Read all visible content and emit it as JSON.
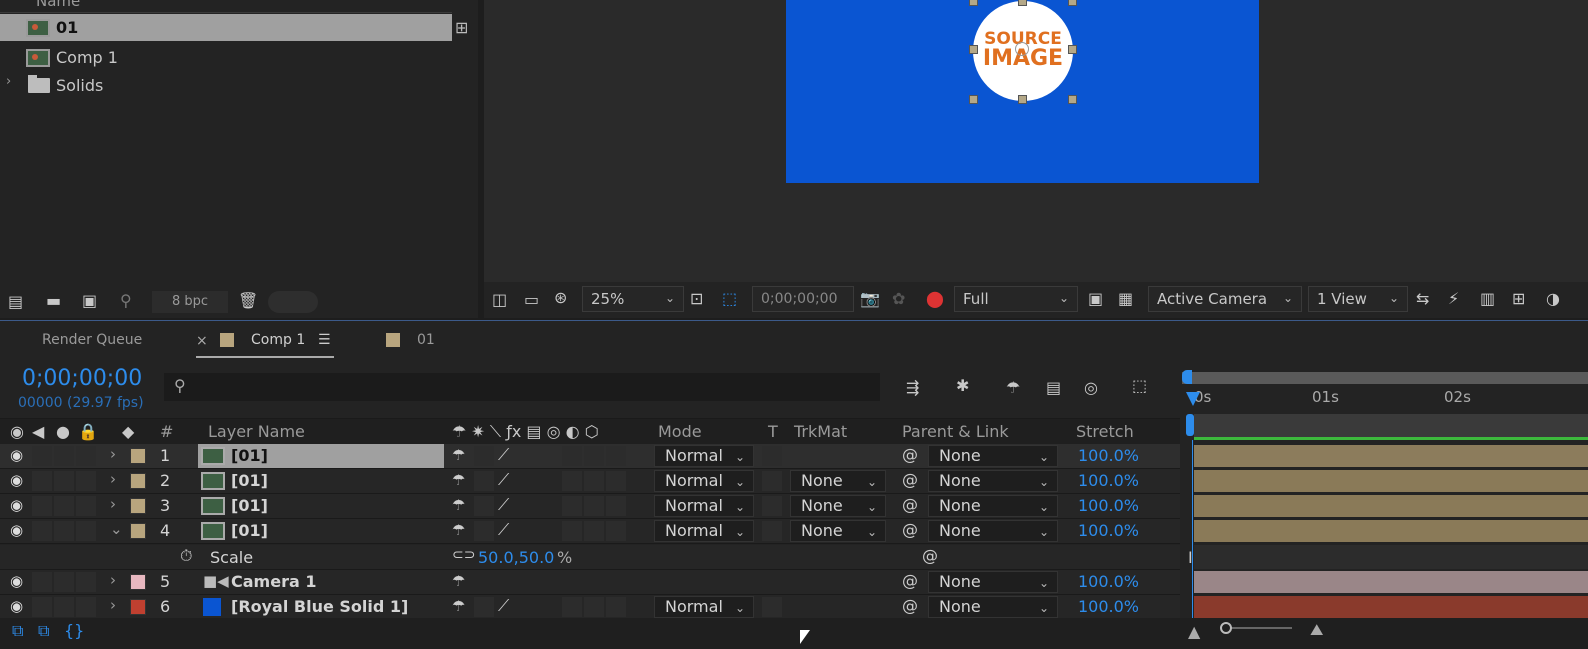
{
  "project": {
    "header": "Name",
    "items": [
      {
        "label": "01"
      },
      {
        "label": "Comp 1"
      },
      {
        "label": "Solids"
      }
    ],
    "footer_bpc": "8 bpc"
  },
  "viewer": {
    "logo_line1": "SOURCE",
    "logo_line2": "IMAGE",
    "zoom": "25%",
    "timecode": "0;00;00;00",
    "resolution": "Full",
    "camera": "Active Camera",
    "views": "1 View"
  },
  "timeline": {
    "tabs": {
      "render_queue": "Render Queue",
      "comp": "Comp 1",
      "footage": "01"
    },
    "current_time": "0;00;00;00",
    "frames_fps": "00000 (29.97 fps)",
    "columns": {
      "hash": "#",
      "layer_name": "Layer Name",
      "mode": "Mode",
      "t": "T",
      "trkmat": "TrkMat",
      "parent": "Parent & Link",
      "stretch": "Stretch"
    },
    "ruler": [
      "0s",
      "01s",
      "02s"
    ],
    "layers": [
      {
        "num": "1",
        "name": "[01]",
        "mode": "Normal",
        "trkmat": "",
        "parent": "None",
        "stretch": "100.0%",
        "color": "#b8a57e",
        "bar": "#8c7c5c"
      },
      {
        "num": "2",
        "name": "[01]",
        "mode": "Normal",
        "trkmat": "None",
        "parent": "None",
        "stretch": "100.0%",
        "color": "#b8a57e",
        "bar": "#8a7a58"
      },
      {
        "num": "3",
        "name": "[01]",
        "mode": "Normal",
        "trkmat": "None",
        "parent": "None",
        "stretch": "100.0%",
        "color": "#b8a57e",
        "bar": "#8a7a58"
      },
      {
        "num": "4",
        "name": "[01]",
        "mode": "Normal",
        "trkmat": "None",
        "parent": "None",
        "stretch": "100.0%",
        "color": "#b8a57e",
        "bar": "#8a7a58"
      },
      {
        "num": "5",
        "name": "Camera 1",
        "mode": "",
        "trkmat": "",
        "parent": "None",
        "stretch": "100.0%",
        "color": "#e8b8c0",
        "bar": "#9a8688"
      },
      {
        "num": "6",
        "name": "[Royal Blue Solid 1]",
        "mode": "Normal",
        "trkmat": "",
        "parent": "None",
        "stretch": "100.0%",
        "color": "#c04030",
        "bar": "#8a3a2c"
      }
    ],
    "scale_prop": {
      "label": "Scale",
      "value": "50.0,50.0",
      "unit": "%"
    }
  }
}
